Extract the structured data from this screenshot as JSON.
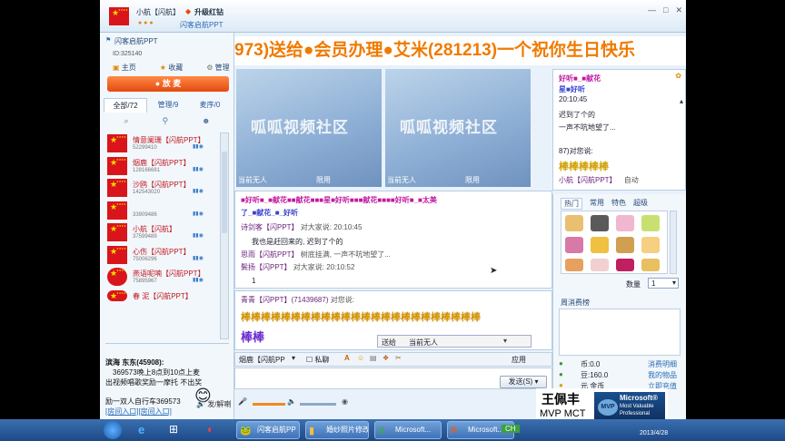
{
  "titlebar": {
    "title": "小航【闪航】",
    "upgrade": "升级红钻",
    "room": "闪客启航PPT",
    "win_minimize": "—",
    "win_maximize": "□",
    "win_close": "✕"
  },
  "left": {
    "room_name": "闪客启航PPT",
    "room_id": "ID:325140",
    "nav": [
      "主页",
      "收藏",
      "管理"
    ],
    "mic_button": "放 麦",
    "tabs": [
      "全部/72",
      "管理/9",
      "麦序/0"
    ],
    "users": [
      {
        "name": "情意阑珊【闪航PPT】",
        "id": "52299410"
      },
      {
        "name": "烟鹿【闪航PPT】",
        "id": "128166681"
      },
      {
        "name": "沙鸥【闪航PPT】",
        "id": "142543020"
      },
      {
        "name": "",
        "id": "33909486"
      },
      {
        "name": "小航【闪航】",
        "id": "37599489"
      },
      {
        "name": "心伤【闪航PPT】",
        "id": "75006296"
      },
      {
        "name": "燕语呢喃【闪航PPT】",
        "id": "75895967"
      },
      {
        "name": "春 泥【闪航PPT】",
        "id": ""
      }
    ],
    "notice": {
      "title": "滨海 东东(45908):",
      "lines": [
        "369573晚上8点到10点上麦",
        "出视频唱歌奖励一摩托 不出奖",
        "励一双人自行车369573"
      ],
      "links": "[房间入口][房间入口]"
    },
    "bottom": "发/解喇"
  },
  "banner": {
    "text": "973)送给●会员办理●艾米(281213)一个祝你生日快乐"
  },
  "video": {
    "logo": "呱呱视频社区",
    "caption_left": "当前无人",
    "caption_right": "限用",
    "caption_left_2": "当前无人",
    "caption_right_2": "限用"
  },
  "chat_public": {
    "rainbow_top": "■好听■_■献花■■献花■■■星■好听■■■献花■■■■好听■_■太美",
    "rainbow_2": "了_■献花_■_好听",
    "lines": [
      {
        "name": "诗剑客【闪PPT】",
        "to": "对大家说:",
        "time": "20:10:45"
      },
      {
        "msg": "我也是赶回来的, 迟到了个的"
      },
      {
        "name": "思雨【闪航PPT】",
        "msg": "树底挂满, 一声不吭地望了..."
      },
      {
        "name": "鬓扬【闪PPT】",
        "to": "对大家说:",
        "time": "20:10:52"
      },
      {
        "msg": "1"
      }
    ]
  },
  "chat_private": {
    "header_name": "青青【闪PPT】(71439687)",
    "header_to": "对您说:",
    "rainbow1": "棒棒棒棒棒棒棒棒棒棒棒棒棒棒棒棒棒棒棒棒棒棒棒棒",
    "rainbow2": "棒棒"
  },
  "right_chat": {
    "rainbow_a": "好听■_■献花",
    "rainbow_b": "星■好听",
    "line1": "迟到了个的",
    "time1": "20:10:45",
    "line2": "一声不吭地望了...",
    "id_line": "87)对您说:",
    "rainbow_c": "棒棒棒棒棒",
    "sender": "小航【闪航PPT】",
    "auto": "自动"
  },
  "gift_tabs": [
    "热门",
    "常用",
    "特色",
    "超级"
  ],
  "gift_panel": {
    "qty_label": "数量",
    "qty_value": "1",
    "weekly": "周消费榜",
    "coins": "币:0.0",
    "beans": "豆:160.0",
    "yuan": "元 金币",
    "details": "消费明细",
    "my_items": "我的物品",
    "recharge": "立即充值"
  },
  "input": {
    "user": "烟鹿【闪航PP",
    "private": "私聊",
    "to_label": "送给",
    "to_value": "当前无人",
    "send": "发送(S)",
    "apply": "应用"
  },
  "mvp": {
    "name": "王佩丰",
    "title": "MVP  MCT",
    "brand": "Microsoft®",
    "line2": "Most Valuable",
    "line3": "Professional",
    "badge": "MVP"
  },
  "taskbar": {
    "items": [
      "闪客启航PP",
      "婚纱照片修改",
      "Microsoft...",
      "Microsoft..."
    ],
    "lang": "CH",
    "time": "2013/4/28"
  },
  "colors": {
    "accent": "#e4490f",
    "banner_text": "#f07a00",
    "username": "#c0181e",
    "taskbar": "#1d4a86"
  }
}
